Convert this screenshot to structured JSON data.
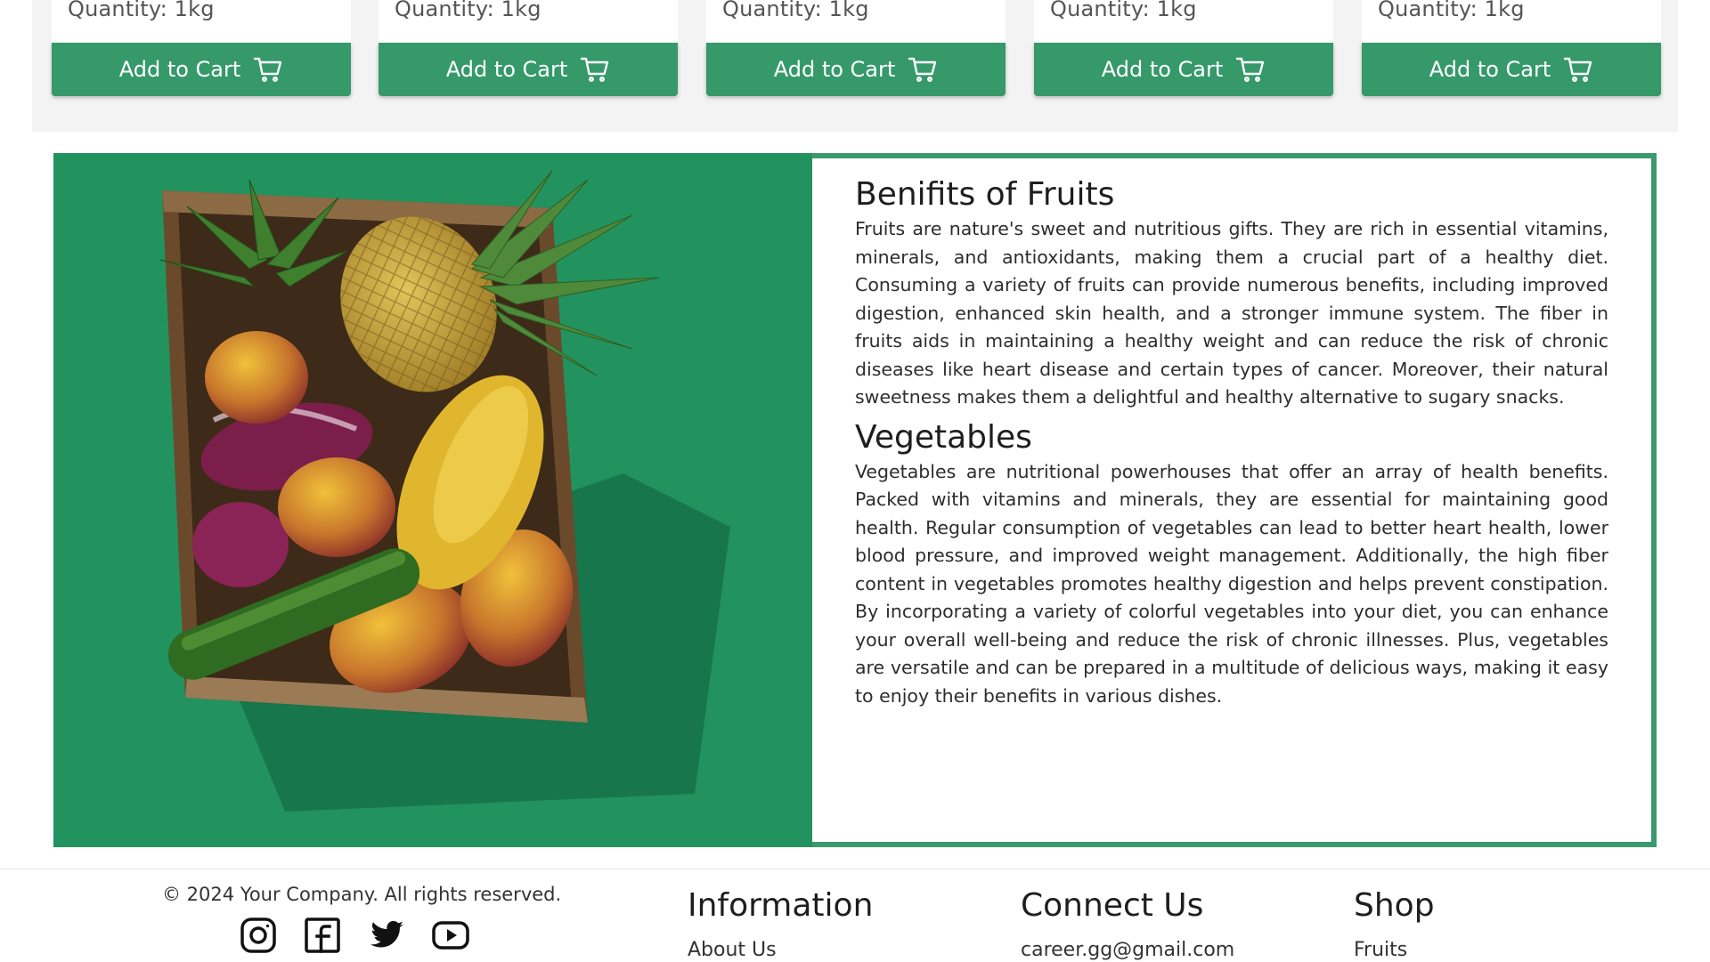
{
  "products": [
    {
      "quantity": "Quantity: 1kg",
      "button_label": "Add to Cart"
    },
    {
      "quantity": "Quantity: 1kg",
      "button_label": "Add to Cart"
    },
    {
      "quantity": "Quantity: 1kg",
      "button_label": "Add to Cart"
    },
    {
      "quantity": "Quantity: 1kg",
      "button_label": "Add to Cart"
    },
    {
      "quantity": "Quantity: 1kg",
      "button_label": "Add to Cart"
    }
  ],
  "benefits": {
    "fruits_title": "Benifits of Fruits",
    "fruits_text": "Fruits are nature's sweet and nutritious gifts. They are rich in essential vitamins, minerals, and antioxidants, making them a crucial part of a healthy diet. Consuming a variety of fruits can provide numerous benefits, including improved digestion, enhanced skin health, and a stronger immune system. The fiber in fruits aids in maintaining a healthy weight and can reduce the risk of chronic diseases like heart disease and certain types of cancer. Moreover, their natural sweetness makes them a delightful and healthy alternative to sugary snacks.",
    "veg_title": "Vegetables",
    "veg_text": "Vegetables are nutritional powerhouses that offer an array of health benefits. Packed with vitamins and minerals, they are essential for maintaining good health. Regular consumption of vegetables can lead to better heart health, lower blood pressure, and improved weight management. Additionally, the high fiber content in vegetables promotes healthy digestion and helps prevent constipation. By incorporating a variety of colorful vegetables into your diet, you can enhance your overall well-being and reduce the risk of chronic illnesses. Plus, vegetables are versatile and can be prepared in a multitude of delicious ways, making it easy to enjoy their benefits in various dishes."
  },
  "footer": {
    "copyright": "© 2024 Your Company. All rights reserved.",
    "socials": [
      "instagram-icon",
      "facebook-icon",
      "twitter-icon",
      "youtube-icon"
    ],
    "information": {
      "title": "Information",
      "link": "About Us"
    },
    "connect": {
      "title": "Connect Us",
      "link": "career.gg@gmail.com"
    },
    "shop": {
      "title": "Shop",
      "link": "Fruits"
    }
  },
  "colors": {
    "brand_green": "#35996a",
    "image_background": "#22925f"
  }
}
